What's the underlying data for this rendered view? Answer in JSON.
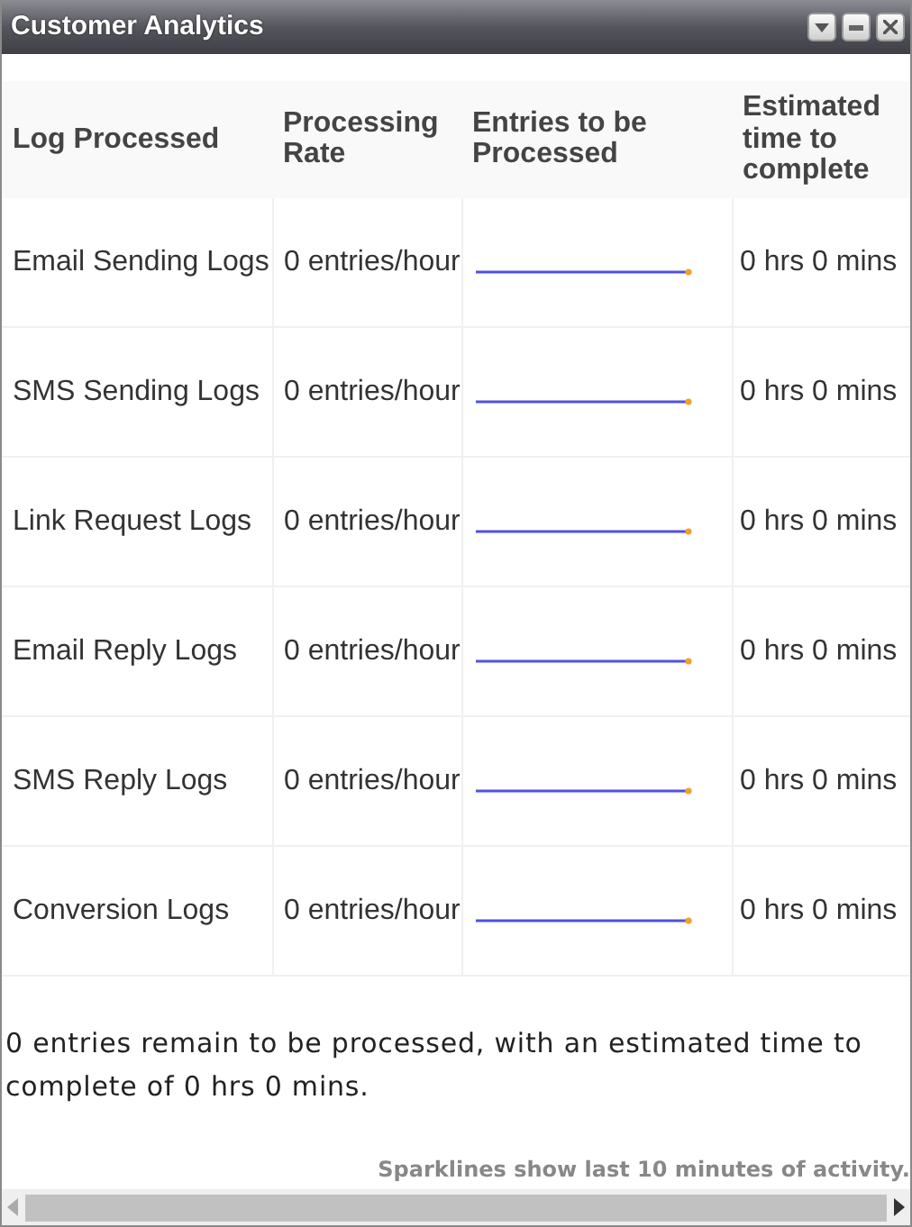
{
  "window": {
    "title": "Customer Analytics"
  },
  "table": {
    "columns": [
      "Log Processed",
      "Processing Rate",
      "Entries to be Processed",
      "Estimated time to complete"
    ],
    "rows": [
      {
        "log": "Email Sending Logs",
        "rate": "0 entries/hour",
        "eta": "0 hrs 0 mins"
      },
      {
        "log": "SMS Sending Logs",
        "rate": "0 entries/hour",
        "eta": "0 hrs 0 mins"
      },
      {
        "log": "Link Request Logs",
        "rate": "0 entries/hour",
        "eta": "0 hrs 0 mins"
      },
      {
        "log": "Email Reply Logs",
        "rate": "0 entries/hour",
        "eta": "0 hrs 0 mins"
      },
      {
        "log": "SMS Reply Logs",
        "rate": "0 entries/hour",
        "eta": "0 hrs 0 mins"
      },
      {
        "log": "Conversion Logs",
        "rate": "0 entries/hour",
        "eta": "0 hrs 0 mins"
      }
    ]
  },
  "summary": "0 entries remain to be processed, with an estimated time to complete of 0 hrs 0 mins.",
  "note": "Sparklines show last 10 minutes of activity."
}
